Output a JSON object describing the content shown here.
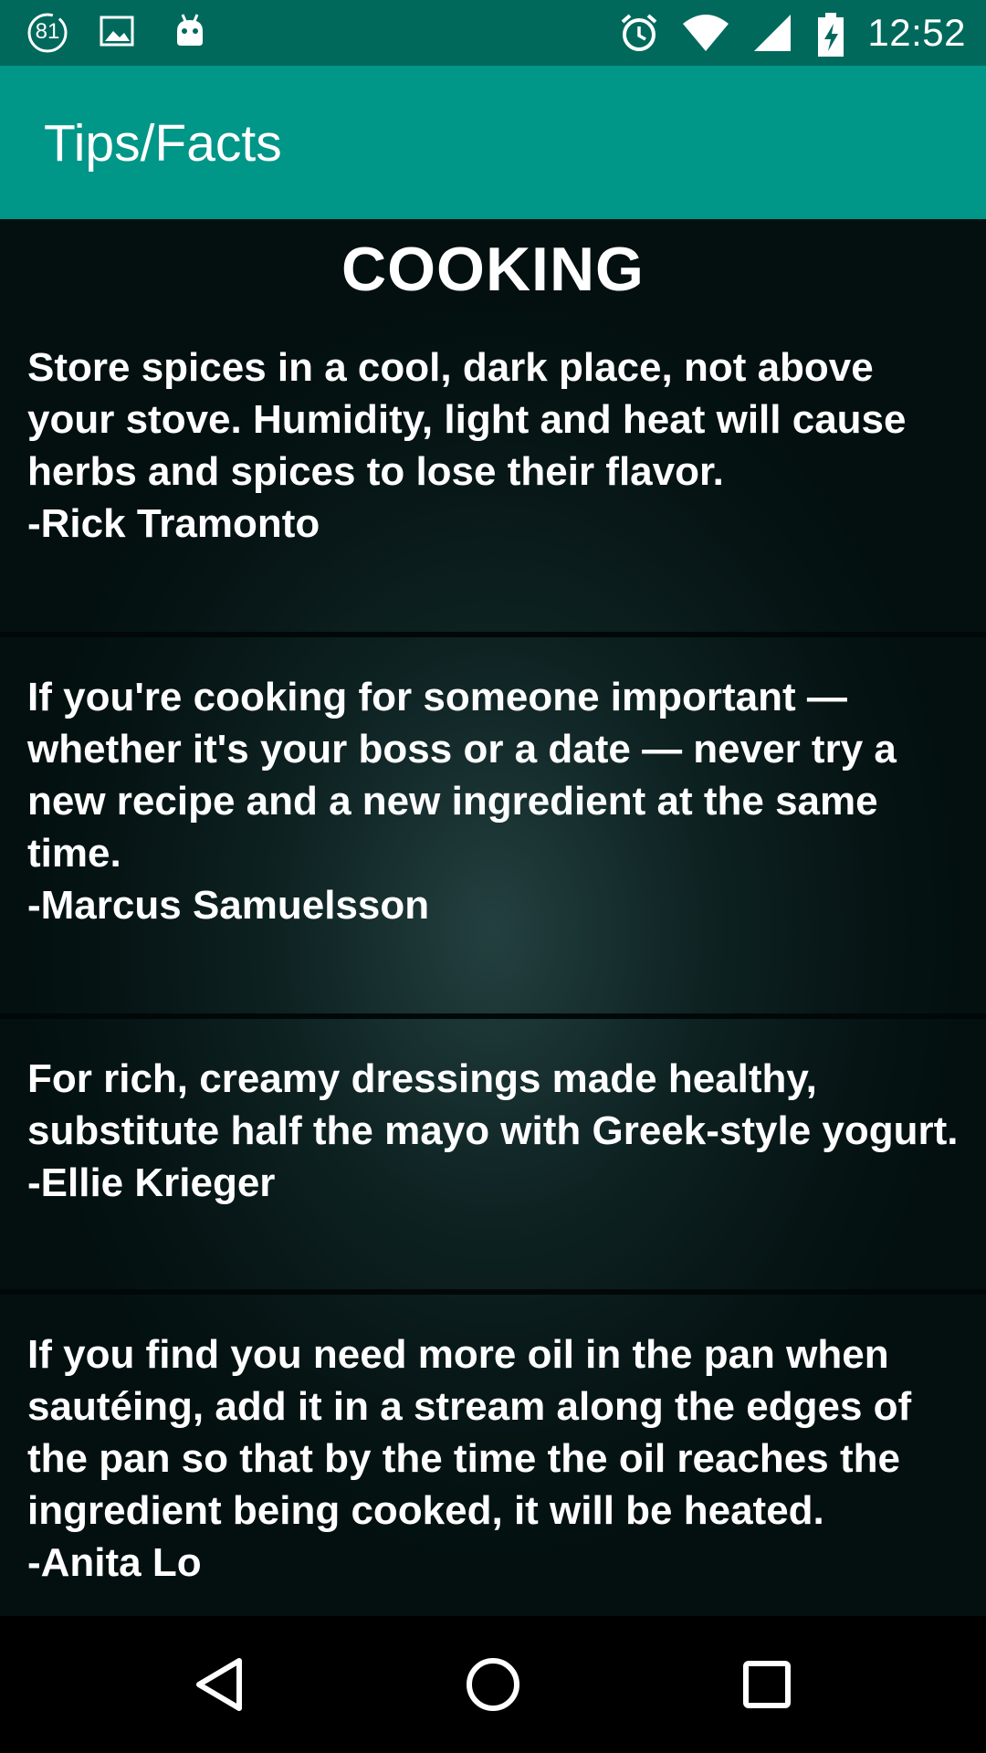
{
  "status_bar": {
    "notification_count": "81",
    "time": "12:52",
    "icons": [
      "notification-count-icon",
      "image-icon",
      "android-icon",
      "alarm-icon",
      "wifi-icon",
      "signal-icon",
      "battery-charging-icon"
    ]
  },
  "app_bar": {
    "title": "Tips/Facts"
  },
  "section": {
    "title": "COOKING"
  },
  "tips": [
    {
      "text": "Store spices in a cool, dark place, not above your stove. Humidity, light and heat will cause herbs and spices to lose their flavor.",
      "author": "-Rick Tramonto"
    },
    {
      "text": "If you're cooking for someone important — whether it's your boss or a date — never try a new recipe and a new ingredient at the same time.",
      "author": "-Marcus Samuelsson"
    },
    {
      "text": "For rich, creamy dressings made healthy, substitute half the mayo with Greek-style yogurt.",
      "author": "-Ellie Krieger"
    },
    {
      "text": "If you find you need more oil in the pan when sautéing, add it in a stream along the edges of the pan so that by the time the oil reaches the ingredient being cooked, it will be heated.",
      "author": "-Anita Lo"
    }
  ],
  "nav_bar": {
    "icons": [
      "back-icon",
      "home-icon",
      "recents-icon"
    ]
  },
  "colors": {
    "status_bar": "#00695c",
    "app_bar": "#009688",
    "background": "#061414",
    "text": "#ffffff"
  }
}
